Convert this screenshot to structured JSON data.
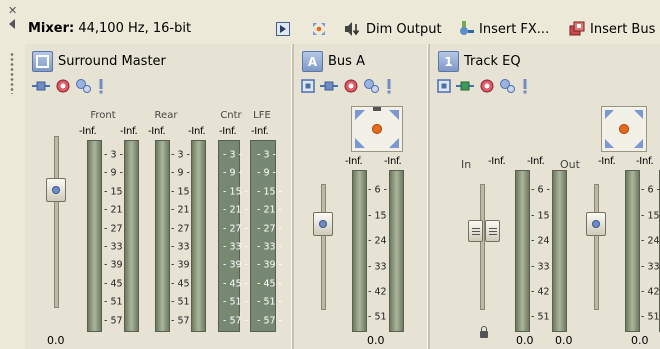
{
  "toolbar": {
    "title_bold": "Mixer:",
    "title_rest": "44,100 Hz, 16-bit",
    "dim_output": "Dim Output",
    "insert_fx": "Insert FX...",
    "insert_bus": "Insert Bus"
  },
  "surround": {
    "name": "Surround Master",
    "channels": [
      "Front",
      "Rear",
      "Cntr",
      "LFE"
    ],
    "peaks": [
      "-Inf.",
      "-Inf.",
      "-Inf.",
      "-Inf.",
      "-Inf.",
      "-Inf."
    ],
    "gain": "0.0"
  },
  "bus_a": {
    "badge": "A",
    "name": "Bus A",
    "peaks": [
      "-Inf.",
      "-Inf."
    ],
    "gain": "0.0"
  },
  "track_eq": {
    "badge": "1",
    "name": "Track EQ",
    "in_label": "In",
    "out_label": "Out",
    "peaks": [
      "-Inf.",
      "-Inf.",
      "-Inf.",
      "-Inf."
    ],
    "gains": [
      "0.0",
      "0.0",
      "0.0"
    ]
  },
  "scales": {
    "six": [
      "3",
      "9",
      "15",
      "21",
      "27",
      "33",
      "39",
      "45",
      "51",
      "57"
    ],
    "four": [
      "6",
      "15",
      "24",
      "33",
      "42",
      "51"
    ]
  },
  "colors": {
    "panel": "#ece9d8",
    "strip_bg": "#e7e3d4",
    "meter": "#aab59c",
    "accent_blue": "#6e8bc2"
  }
}
